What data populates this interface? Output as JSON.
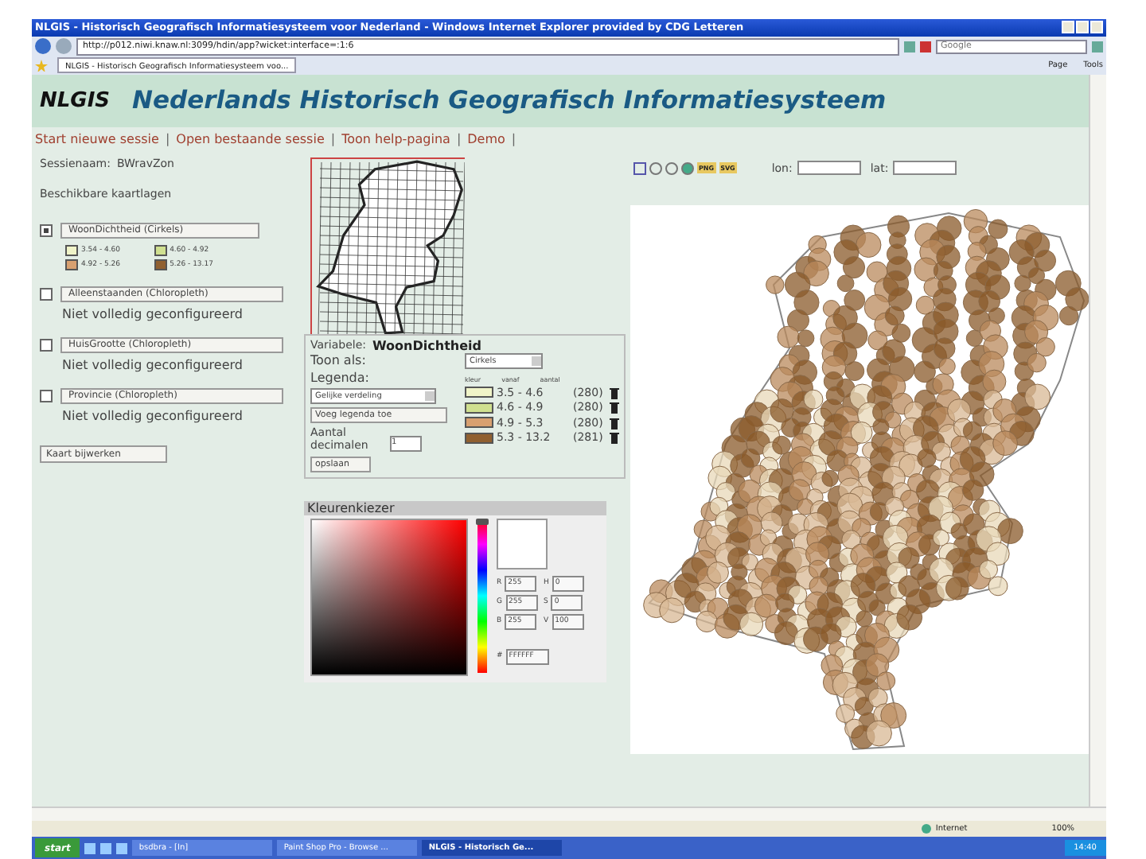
{
  "window": {
    "title": "NLGIS - Historisch Geografisch Informatiesysteem voor Nederland - Windows Internet Explorer provided by CDG Letteren"
  },
  "browser": {
    "address": "http://p012.niwi.knaw.nl:3099/hdin/app?wicket:interface=:1:6",
    "search_placeholder": "Google",
    "tab": "NLGIS - Historisch Geografisch Informatiesysteem voo...",
    "toolbar": [
      "Page",
      "Tools"
    ]
  },
  "header": {
    "logo": "NLGIS",
    "title": "Nederlands Historisch Geografisch Informatiesysteem"
  },
  "nav": [
    {
      "label": "Start nieuwe sessie",
      "separator": "|"
    },
    {
      "label": "Open bestaande sessie",
      "separator": "|"
    },
    {
      "label": "Toon help-pagina",
      "separator": "|"
    },
    {
      "label": "Demo",
      "separator": "|"
    }
  ],
  "session": {
    "label": "Sessienaam:",
    "value": "BWravZon"
  },
  "layers_heading": "Beschikbare kaartlagen",
  "layers": [
    {
      "name": "WoonDichtheid (Cirkels)",
      "checked": true,
      "legend": [
        {
          "range": "3.54 - 4.60",
          "color": "#f0f4c8"
        },
        {
          "range": "4.60 - 4.92",
          "color": "#d0e090"
        },
        {
          "range": "4.92 - 5.26",
          "color": "#d8a070"
        },
        {
          "range": "5.26 - 13.17",
          "color": "#906030"
        }
      ]
    },
    {
      "name": "Alleenstaanden (Chloropleth)",
      "checked": false,
      "status": "Niet volledig geconfigureerd"
    },
    {
      "name": "HuisGrootte (Chloropleth)",
      "checked": false,
      "status": "Niet volledig geconfigureerd"
    },
    {
      "name": "Provincie (Chloropleth)",
      "checked": false,
      "status": "Niet volledig geconfigureerd"
    }
  ],
  "update_button": "Kaart bijwerken",
  "variable_panel": {
    "variable_label": "Variabele:",
    "variable": "WoonDichtheid",
    "show_as_label": "Toon als:",
    "show_as": "Cirkels",
    "legend_label": "Legenda:",
    "legend_type": "Gelijke verdeling",
    "add_legend_button": "Voeg legenda toe",
    "decimals_label": "Aantal decimalen",
    "decimals": "1",
    "save_button": "opslaan",
    "columns": [
      "kleur",
      "vanaf",
      "aantal"
    ],
    "classes": [
      {
        "color": "#f0f4c8",
        "range": "3.5 - 4.6",
        "count": "(280)"
      },
      {
        "color": "#d0e090",
        "range": "4.6 - 4.9",
        "count": "(280)"
      },
      {
        "color": "#d8a070",
        "range": "4.9 - 5.3",
        "count": "(280)"
      },
      {
        "color": "#906030",
        "range": "5.3 - 13.2",
        "count": "(281)"
      }
    ]
  },
  "color_picker": {
    "title": "Kleurenkiezer",
    "hue_slider": {
      "level": 1
    },
    "fields": [
      {
        "label": "R",
        "value": "255"
      },
      {
        "label": "H",
        "value": "0"
      },
      {
        "label": "G",
        "value": "255"
      },
      {
        "label": "S",
        "value": "0"
      },
      {
        "label": "B",
        "value": "255"
      },
      {
        "label": "V",
        "value": "100"
      }
    ],
    "hex_label": "#",
    "hex": "FFFFFF"
  },
  "map_tools": {
    "export_buttons": [
      "PNG",
      "SVG"
    ],
    "lon_label": "lon:",
    "lat_label": "lat:"
  },
  "status_bar": {
    "zone": "Internet",
    "zoom": "100%"
  },
  "taskbar": {
    "start": "start",
    "tasks": [
      {
        "label": "bsdbra - [In]",
        "selected": false
      },
      {
        "label": "Paint Shop Pro - Browse ...",
        "selected": false
      },
      {
        "label": "NLGIS - Historisch Ge...",
        "selected": true
      }
    ],
    "clock": "14:40"
  }
}
